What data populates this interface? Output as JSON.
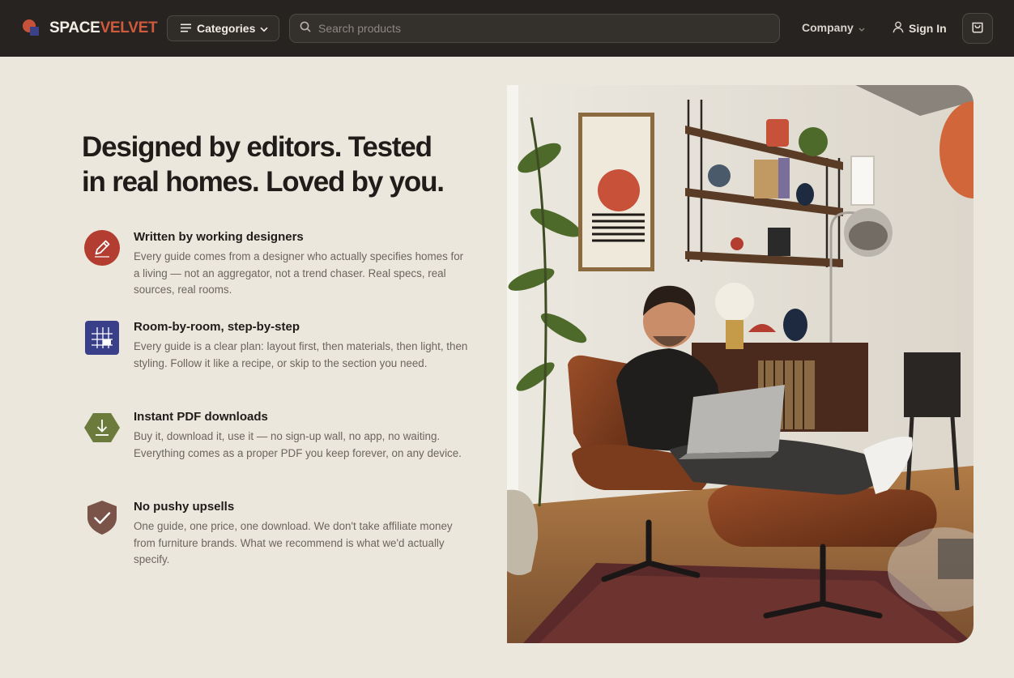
{
  "brand": {
    "part1": "SPACE",
    "part2": "VELVET",
    "accent": "#d05a3c"
  },
  "nav": {
    "categories_label": "Categories",
    "search_placeholder": "Search products",
    "company_label": "Company",
    "signin_label": "Sign In"
  },
  "hero": {
    "headline_line1": "Designed by editors. Tested",
    "headline_line2": "in real homes. Loved by you.",
    "image_alt": "Man relaxing in a leather lounge chair with a laptop in a sunlit living room"
  },
  "features": [
    {
      "title": "Written by working designers",
      "desc": "Every guide comes from a designer who actually specifies homes for a living — not an aggregator, not a trend chaser. Real specs, real sources, real rooms.",
      "icon": "pencil-icon",
      "color": "#b23d30"
    },
    {
      "title": "Room-by-room, step-by-step",
      "desc": "Every guide is a clear plan: layout first, then materials, then light, then styling. Follow it like a recipe, or skip to the section you need.",
      "icon": "grid-icon",
      "color": "#3a3f8a"
    },
    {
      "title": "Instant PDF downloads",
      "desc": "Buy it, download it, use it — no sign-up wall, no app, no waiting. Everything comes as a proper PDF you keep forever, on any device.",
      "icon": "download-icon",
      "color": "#6c7a3c"
    },
    {
      "title": "No pushy upsells",
      "desc": "One guide, one price, one download. We don't take affiliate money from furniture brands. What we recommend is what we'd actually specify.",
      "icon": "shield-check-icon",
      "color": "#7a5448"
    }
  ]
}
